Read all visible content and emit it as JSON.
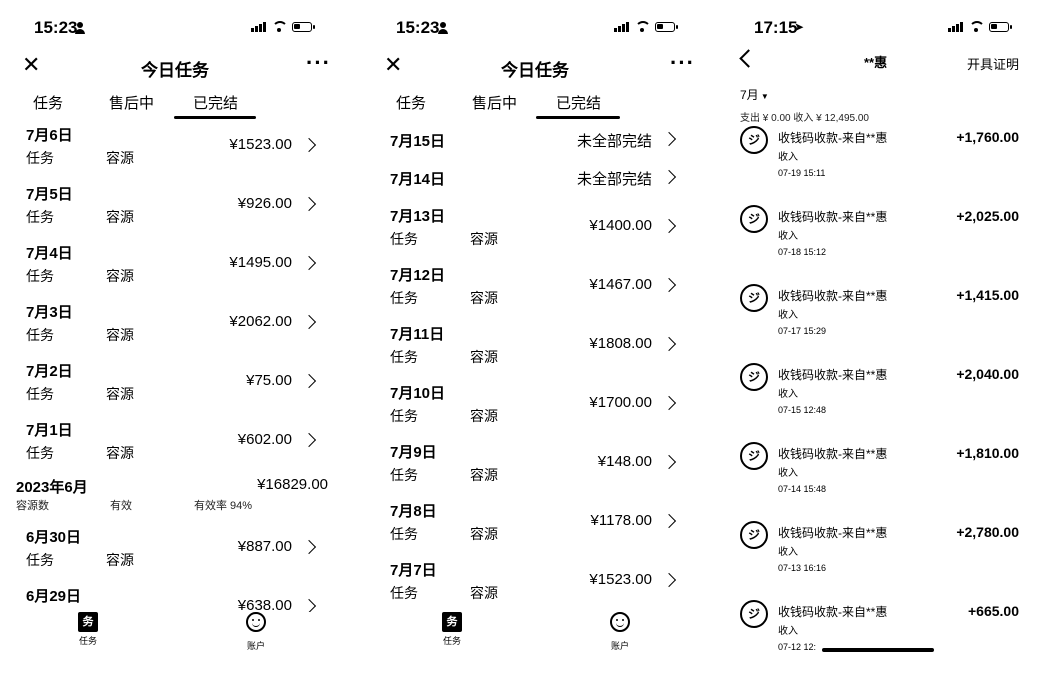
{
  "screen1": {
    "status_time": "15:23",
    "nav_title": "今日任务",
    "tabs": [
      "任务",
      "售后中",
      "已完结"
    ],
    "rows_a": [
      {
        "date": "7月6日",
        "l1": "任务",
        "l2": "容源",
        "amount": "¥1523.00"
      },
      {
        "date": "7月5日",
        "l1": "任务",
        "l2": "容源",
        "amount": "¥926.00"
      },
      {
        "date": "7月4日",
        "l1": "任务",
        "l2": "容源",
        "amount": "¥1495.00"
      },
      {
        "date": "7月3日",
        "l1": "任务",
        "l2": "容源",
        "amount": "¥2062.00"
      },
      {
        "date": "7月2日",
        "l1": "任务",
        "l2": "容源",
        "amount": "¥75.00"
      },
      {
        "date": "7月1日",
        "l1": "任务",
        "l2": "容源",
        "amount": "¥602.00"
      }
    ],
    "summary": {
      "month": "2023年6月",
      "total": "¥16829.00",
      "s1": "容源数",
      "s2": "有效",
      "s3": "有效率 94%"
    },
    "rows_b": [
      {
        "date": "6月30日",
        "l1": "任务",
        "l2": "容源",
        "amount": "¥887.00"
      },
      {
        "date": "6月29日",
        "l1": "",
        "l2": "",
        "amount": "¥638.00"
      }
    ],
    "bottom_nav": [
      {
        "label": "任务",
        "icon": "task-icon"
      },
      {
        "label": "账户",
        "icon": "account-icon"
      }
    ]
  },
  "screen2": {
    "status_time": "15:23",
    "nav_title": "今日任务",
    "tabs": [
      "任务",
      "售后中",
      "已完结"
    ],
    "pending_rows": [
      {
        "date": "7月15日",
        "note": "未全部完结"
      },
      {
        "date": "7月14日",
        "note": "未全部完结"
      }
    ],
    "rows": [
      {
        "date": "7月13日",
        "l1": "任务",
        "l2": "容源",
        "amount": "¥1400.00"
      },
      {
        "date": "7月12日",
        "l1": "任务",
        "l2": "容源",
        "amount": "¥1467.00"
      },
      {
        "date": "7月11日",
        "l1": "任务",
        "l2": "容源",
        "amount": "¥1808.00"
      },
      {
        "date": "7月10日",
        "l1": "任务",
        "l2": "容源",
        "amount": "¥1700.00"
      },
      {
        "date": "7月9日",
        "l1": "任务",
        "l2": "容源",
        "amount": "¥148.00"
      },
      {
        "date": "7月8日",
        "l1": "任务",
        "l2": "容源",
        "amount": "¥1178.00"
      },
      {
        "date": "7月7日",
        "l1": "任务",
        "l2": "容源",
        "amount": "¥1523.00"
      }
    ],
    "bottom_nav": [
      {
        "label": "任务",
        "icon": "task-icon"
      },
      {
        "label": "账户",
        "icon": "account-icon"
      }
    ]
  },
  "screen3": {
    "status_time": "17:15",
    "title": "**惠",
    "proof_button": "开具证明",
    "month_selector": "7月",
    "stats": "支出 ¥ 0.00    收入 ¥ 12,495.00",
    "transactions": [
      {
        "title": "收钱码收款-来自**惠",
        "sub": "收入",
        "time": "07-19 15:11",
        "amount": "+1,760.00"
      },
      {
        "title": "收钱码收款-来自**惠",
        "sub": "收入",
        "time": "07-18 15:12",
        "amount": "+2,025.00"
      },
      {
        "title": "收钱码收款-来自**惠",
        "sub": "收入",
        "time": "07-17 15:29",
        "amount": "+1,415.00"
      },
      {
        "title": "收钱码收款-来自**惠",
        "sub": "收入",
        "time": "07-15 12:48",
        "amount": "+2,040.00"
      },
      {
        "title": "收钱码收款-来自**惠",
        "sub": "收入",
        "time": "07-14 15:48",
        "amount": "+1,810.00"
      },
      {
        "title": "收钱码收款-来自**惠",
        "sub": "收入",
        "time": "07-13 16:16",
        "amount": "+2,780.00"
      },
      {
        "title": "收钱码收款-来自**惠",
        "sub": "收入",
        "time": "07-12 12:",
        "amount": "+665.00"
      }
    ]
  }
}
